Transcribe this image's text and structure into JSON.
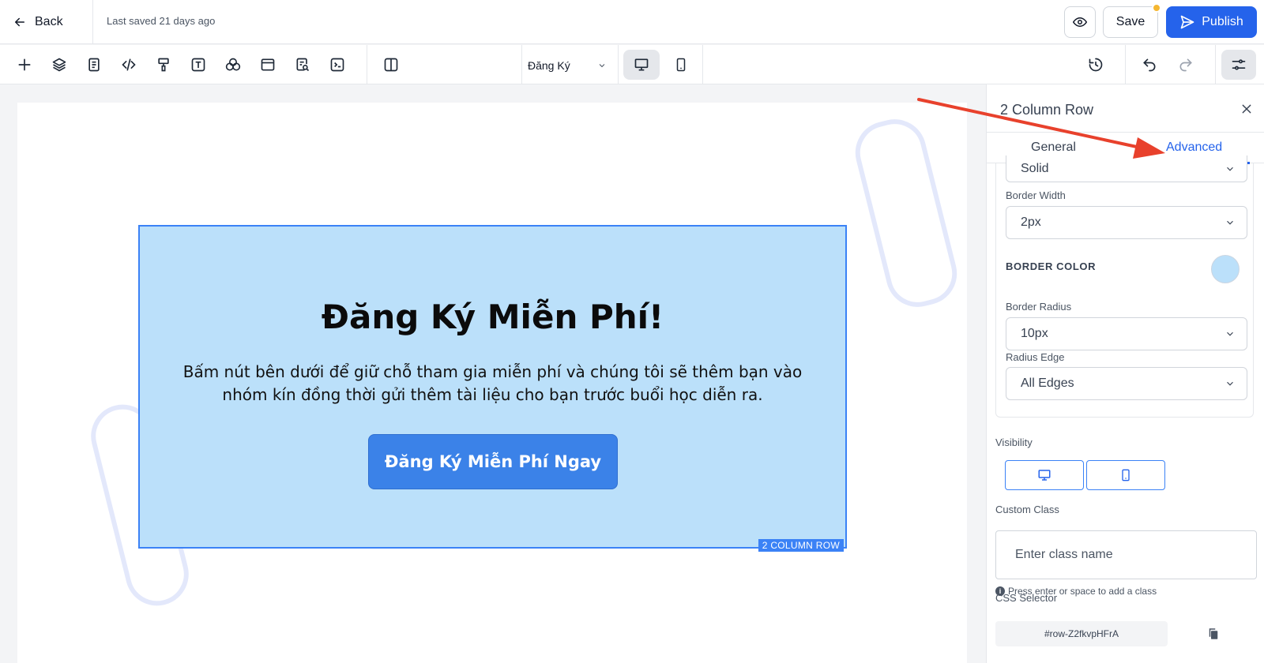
{
  "topbar": {
    "back_label": "Back",
    "last_saved": "Last saved 21 days ago",
    "save_label": "Save",
    "publish_label": "Publish"
  },
  "toolbar": {
    "tools": [
      "add-icon",
      "layers-icon",
      "page-icon",
      "code-icon",
      "paint-roller-icon",
      "text-icon",
      "shapes-icon",
      "layout-icon",
      "search-doc-icon",
      "terminal-icon",
      "columns-icon"
    ],
    "page_select": "Đăng Ký",
    "devices": [
      "desktop-icon",
      "mobile-icon"
    ],
    "right_tools": [
      "history-icon",
      "undo-icon",
      "redo-icon",
      "settings-sliders-icon"
    ]
  },
  "canvas": {
    "row_title": "Đăng Ký Miễn Phí!",
    "row_description": "Bấm nút bên dưới để giữ chỗ tham gia miễn phí và chúng tôi sẽ thêm bạn vào nhóm kín đồng thời gửi thêm tài liệu cho bạn trước buổi học diễn ra.",
    "cta_label": "Đăng Ký Miễn Phí Ngay",
    "row_tag": "2 COLUMN ROW",
    "row_background": "#bbe0fa",
    "cta_color": "#3b82e8"
  },
  "panel": {
    "title": "2 Column Row",
    "tabs": [
      {
        "label": "General",
        "active": false
      },
      {
        "label": "Advanced",
        "active": true
      }
    ],
    "border_style_value": "Solid",
    "border_width_label": "Border Width",
    "border_width_value": "2px",
    "border_color_label": "BORDER COLOR",
    "border_color_value": "#bbe0fa",
    "border_radius_label": "Border Radius",
    "border_radius_value": "10px",
    "radius_edge_label": "Radius Edge",
    "radius_edge_value": "All Edges",
    "visibility_label": "Visibility",
    "custom_class_label": "Custom Class",
    "custom_class_placeholder": "Enter class name",
    "custom_class_hint": "Press enter or space to add a class",
    "css_selector_label": "CSS Selector",
    "css_selector_value": "#row-Z2fkvpHFrA"
  },
  "colors": {
    "accent": "#2563eb",
    "annotation_arrow": "#e8412c",
    "save_indicator": "#f5b731"
  }
}
